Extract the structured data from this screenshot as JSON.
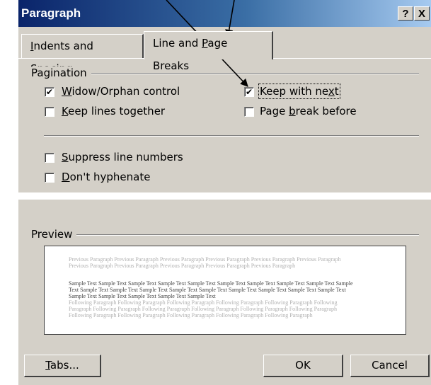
{
  "window": {
    "title": "Paragraph",
    "help_label": "?",
    "close_label": "X"
  },
  "tabs": [
    {
      "label_pre": "",
      "mnemonic": "I",
      "label_post": "ndents and Spacing",
      "active": false
    },
    {
      "label_pre": "Line and ",
      "mnemonic": "P",
      "label_post": "age Breaks",
      "active": true
    }
  ],
  "pagination": {
    "group_label": "Pagination",
    "widow": {
      "mnemonic": "W",
      "rest": "idow/Orphan control",
      "checked": true
    },
    "keep_lines": {
      "mnemonic": "K",
      "rest": "eep lines together",
      "checked": false
    },
    "keep_next": {
      "pre": "Keep with ne",
      "mnemonic": "x",
      "post": "t",
      "checked": true
    },
    "page_break": {
      "pre": "Page ",
      "mnemonic": "b",
      "post": "reak before",
      "checked": false
    }
  },
  "suppress": {
    "mnemonic": "S",
    "rest": "uppress line numbers",
    "checked": false
  },
  "hyphenate": {
    "mnemonic": "D",
    "rest": "on't hyphenate",
    "checked": false
  },
  "check_mark": "✔",
  "preview": {
    "group_label": "Preview",
    "previous": "Previous Paragraph Previous Paragraph Previous Paragraph Previous Paragraph Previous Paragraph Previous Paragraph Previous Paragraph Previous Paragraph Previous Paragraph Previous Paragraph Previous Paragraph",
    "sample": "Sample Text Sample Text Sample Text Sample Text Sample Text Sample Text Sample Text Sample Text Sample Text Sample Text Sample Text Sample Text Sample Text Sample Text Sample Text Sample Text Sample Text Sample Text Sample Text Sample Text Sample Text Sample Text Sample Text Sample Text",
    "following": "Following Paragraph Following Paragraph Following Paragraph Following Paragraph Following Paragraph Following Paragraph Following Paragraph Following Paragraph Following Paragraph Following Paragraph Following Paragraph Following Paragraph Following Paragraph Following Paragraph Following Paragraph Following Paragraph"
  },
  "buttons": {
    "tabs": {
      "mnemonic": "T",
      "rest": "abs..."
    },
    "ok": "OK",
    "cancel": "Cancel"
  }
}
